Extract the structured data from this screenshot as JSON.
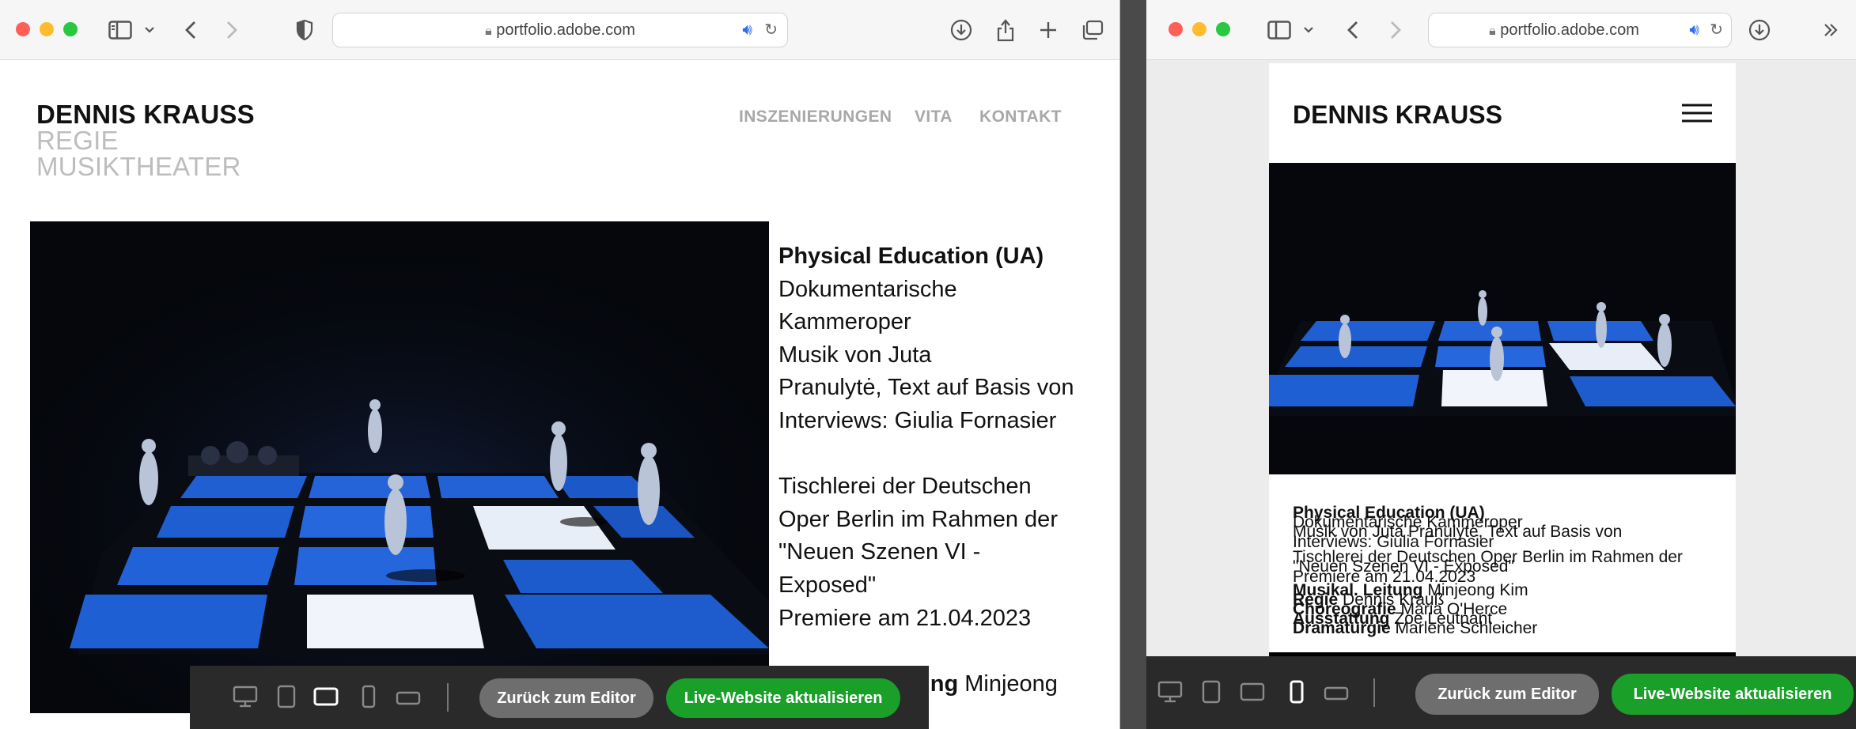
{
  "browser_left": {
    "url": "portfolio.adobe.com"
  },
  "browser_right": {
    "url": "portfolio.adobe.com"
  },
  "site": {
    "brand_name": "DENNIS KRAUSS",
    "brand_sub1": "REGIE",
    "brand_sub2": "MUSIKTHEATER",
    "nav": [
      "INSZENIERUNGEN",
      "VITA",
      "KONTAKT"
    ]
  },
  "production": {
    "title": "Physical Education (UA)",
    "left_lines": [
      "Dokumentarische",
      "Kammeroper",
      "Musik von Juta",
      "Pranulytė, Text auf Basis von",
      "Interviews: Giulia Fornasier",
      "",
      "Tischlerei der Deutschen",
      "Oper Berlin im Rahmen der",
      "\"Neuen Szenen VI -",
      "Exposed\"",
      "Premiere am 21.04.2023",
      ""
    ],
    "left_bottom_label": "Musikal. Leitung",
    "left_bottom_value": "Minjeong",
    "left_bottom_value2": "Kim",
    "right_lines": {
      "title": "Physical Education (UA)",
      "l1": "Dokumentarische Kammeroper",
      "l2": "Musik von Juta Pranulytė, Text auf Basis von",
      "l3": "Interviews: Giulia Fornasier",
      "l4": "Tischlerei der Deutschen Oper Berlin im Rahmen der",
      "l5": "\"Neuen Szenen VI - Exposed\"",
      "l6": "Premiere am 21.04.2023",
      "c1_label": "Musikal. Leitung",
      "c1_value": "Minjeong Kim",
      "c2_label": "Regie",
      "c2_value": "Dennis Krauß",
      "c3_label": "Choreografie",
      "c3_value": "Maria O'Herce",
      "c4_label": "Ausstattung",
      "c4_value": "Zoe Leutnant",
      "c5_label": "Dramaturgie",
      "c5_value": "Marlene Schleicher"
    }
  },
  "editor_bar": {
    "back_label": "Zurück zum Editor",
    "publish_label": "Live-Website aktualisieren"
  },
  "colors": {
    "accent_green": "#1a9f29",
    "stage_blue": "#1f62d6",
    "nav_grey": "#a8a8a8"
  },
  "icons": {
    "sidebar": "sidebar-icon",
    "back": "chevron-left-icon",
    "forward": "chevron-right-icon",
    "shield": "shield-icon",
    "lock": "lock-icon",
    "audio": "speaker-icon",
    "reload": "reload-icon",
    "download": "download-icon",
    "share": "share-icon",
    "new_tab": "plus-icon",
    "tabs": "tabs-overview-icon",
    "menu": "hamburger-menu-icon"
  }
}
